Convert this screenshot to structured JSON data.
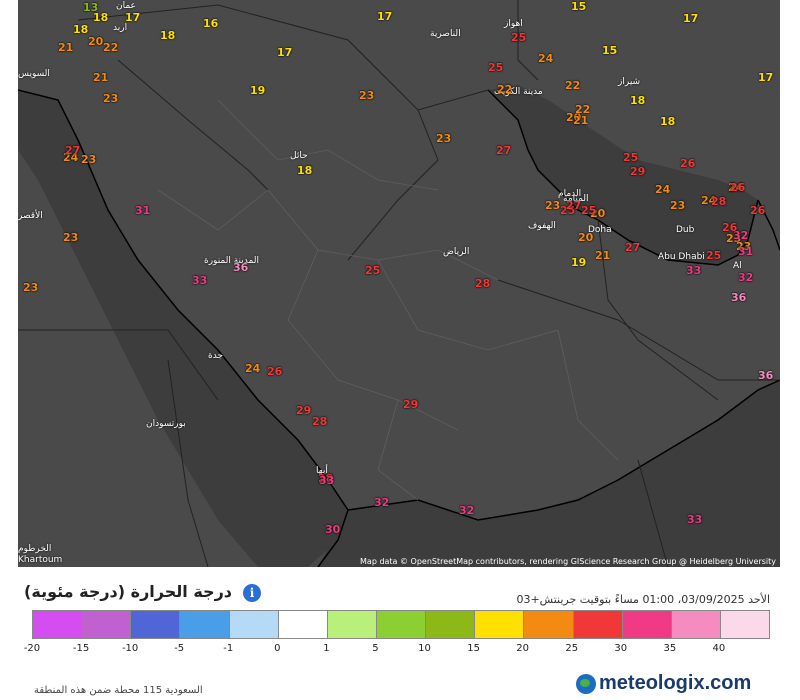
{
  "legend": {
    "title": "درجة الحرارة (درجة مئوية)",
    "info_icon": "info-icon",
    "datetime": "الأحد 03/09/2025، 01:00 مساءً بتوقيت جرينتش+03",
    "stations": "السعودية 115 محطة ضمن هذه المنطقة",
    "brand": "meteologix.com",
    "colors": [
      "#d34df0",
      "#bf62cf",
      "#5066d6",
      "#4a9ee8",
      "#b5daf8",
      "#ffffff",
      "#b8f07a",
      "#8ccf32",
      "#8cb818",
      "#ffe000",
      "#f38a12",
      "#f03838",
      "#f13a86",
      "#f58cbf",
      "#fcd9e9"
    ],
    "ticks": [
      "-20",
      "-15",
      "-10",
      "-5",
      "-1",
      "0",
      "1",
      "5",
      "10",
      "15",
      "20",
      "25",
      "30",
      "35",
      "40"
    ]
  },
  "map": {
    "attribution": "Map data © OpenStreetMap contributors, rendering GIScience Research Group @ Heidelberg University",
    "cities": [
      "عمان",
      "اربد",
      "الناصرية",
      "اهواز",
      "السويس",
      "شيراز",
      "مدينة الكويت",
      "حائل",
      "الدمام",
      "المنامة",
      "الهفوف",
      "Doha",
      "الرياض",
      "المدينة المنورة",
      "Dub",
      "Abu Dhabi",
      "Al",
      "جدة",
      "بورتسودان",
      "الأقصر",
      "أبها",
      "الخرطوم",
      "Khartoum"
    ],
    "temps": [
      "13",
      "17",
      "21",
      "18",
      "16",
      "17",
      "15",
      "17",
      "18",
      "20",
      "22",
      "21",
      "18",
      "19",
      "17",
      "23",
      "22",
      "25",
      "24",
      "15",
      "22",
      "18",
      "23",
      "23",
      "24",
      "27",
      "25",
      "20",
      "17",
      "18",
      "23",
      "22",
      "21",
      "18",
      "25",
      "24",
      "29",
      "23",
      "26",
      "20",
      "23",
      "25",
      "25",
      "24",
      "27",
      "28",
      "24",
      "23",
      "23",
      "26",
      "26",
      "27",
      "19",
      "20",
      "21",
      "32",
      "26",
      "31",
      "25",
      "32",
      "33",
      "36",
      "23",
      "27",
      "31",
      "33",
      "36",
      "29",
      "24",
      "28",
      "28",
      "30",
      "33",
      "32",
      "32",
      "33",
      "36",
      "25",
      "23",
      "29",
      "26",
      "28"
    ]
  }
}
